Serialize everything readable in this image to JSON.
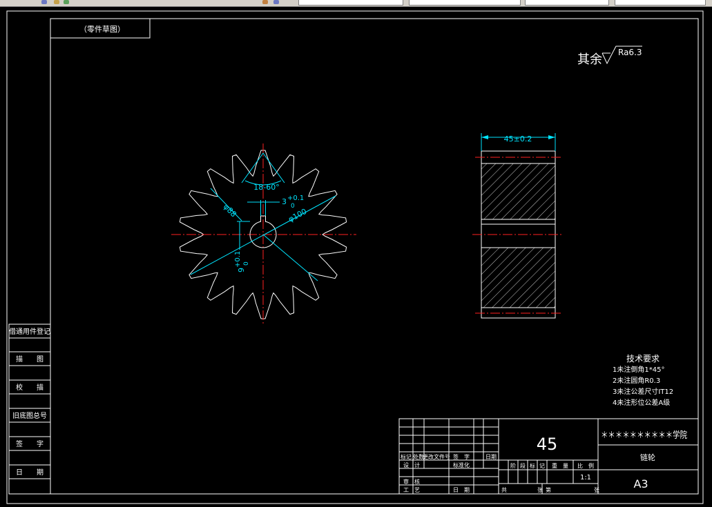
{
  "drawing": {
    "sheet_label": "（零件草图）",
    "roughness_prefix": "其余",
    "roughness_value": "Ra6.3",
    "dims": {
      "angle": "18-60°",
      "keyway_width_main": "3",
      "keyway_width_upper": "+0.1",
      "keyway_width_lower": "0",
      "pitch_dia": "φ88",
      "outer_dia": "φ100",
      "key_depth_main": "9",
      "key_depth_upper": "+0.1",
      "key_depth_lower": "0",
      "face_width": "45±0.2"
    },
    "tech_requirements": {
      "title": "技术要求",
      "items": [
        "1未注倒角1*45°",
        "2未注圆角R0.3",
        "3未注公差尺寸IT12",
        "4未注形位公差A级"
      ]
    },
    "side_panel": [
      "借通用件登记",
      "描　　图",
      "校　　描",
      "旧底图总号",
      "签　　字",
      "日　　期"
    ],
    "title_block": {
      "material": "45",
      "school": "＊＊＊＊＊＊＊＊＊＊学院",
      "part_name": "链轮",
      "sheet_size": "A3",
      "scale": "1:1",
      "header_labels": [
        "标记",
        "处数",
        "更改文件号",
        "签　字",
        "日期"
      ],
      "row_design": "设　计",
      "row_std": "标准化",
      "row_review": "审　核",
      "row_process": "工　艺",
      "row_date": "日　期",
      "stage_labels": [
        "阶",
        "段",
        "标",
        "记"
      ],
      "weight_label": "重　量",
      "scale_label": "比　例",
      "sheet_total": "共",
      "sheet_page": "第",
      "sheet_unit1": "张",
      "sheet_unit2": "张"
    }
  }
}
